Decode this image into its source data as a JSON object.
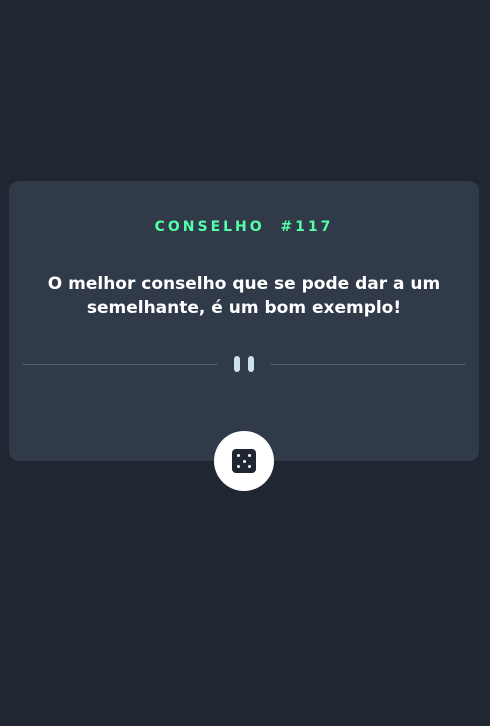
{
  "card": {
    "advice_label": "CONSELHO",
    "advice_number": "#117",
    "advice_text": "O melhor conselho que se pode dar a um semelhante, é um bom exemplo!"
  },
  "icons": {
    "divider": "pause-icon",
    "button": "dice-icon"
  },
  "colors": {
    "background": "#202733",
    "card": "#313a49",
    "accent": "#53ffaa",
    "text": "#ffffff",
    "divider": "#4f5d74"
  }
}
